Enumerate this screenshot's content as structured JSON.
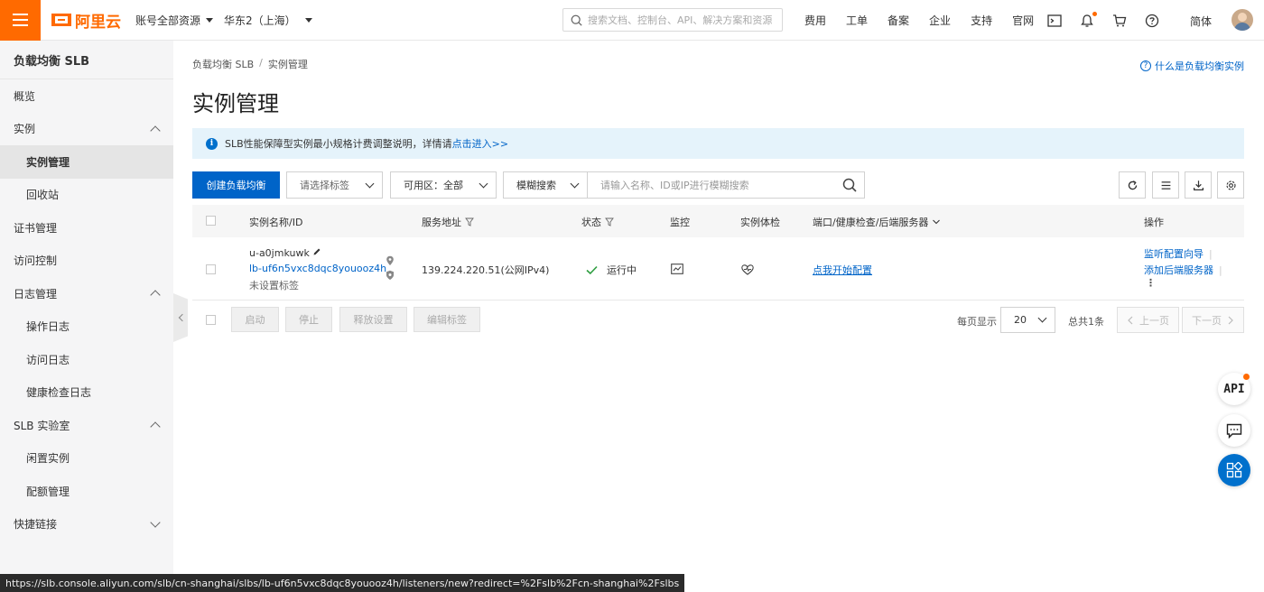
{
  "topbar": {
    "logo_text": "阿里云",
    "account_select": "账号全部资源",
    "region_select": "华东2（上海）",
    "search_placeholder": "搜索文档、控制台、API、解决方案和资源",
    "links": [
      "费用",
      "工单",
      "备案",
      "企业",
      "支持",
      "官网"
    ],
    "language": "简体",
    "accent_color": "#ff6a00"
  },
  "sidebar": {
    "title": "负载均衡 SLB",
    "items": [
      {
        "label": "概览",
        "level": 1
      },
      {
        "label": "实例",
        "level": 1,
        "expandable": true,
        "expanded": true
      },
      {
        "label": "实例管理",
        "level": 2,
        "active": true
      },
      {
        "label": "回收站",
        "level": 2
      },
      {
        "label": "证书管理",
        "level": 1
      },
      {
        "label": "访问控制",
        "level": 1
      },
      {
        "label": "日志管理",
        "level": 1,
        "expandable": true,
        "expanded": true
      },
      {
        "label": "操作日志",
        "level": 2
      },
      {
        "label": "访问日志",
        "level": 2
      },
      {
        "label": "健康检查日志",
        "level": 2
      },
      {
        "label": "SLB 实验室",
        "level": 1,
        "expandable": true,
        "expanded": true
      },
      {
        "label": "闲置实例",
        "level": 2
      },
      {
        "label": "配额管理",
        "level": 2
      },
      {
        "label": "快捷链接",
        "level": 1,
        "expandable": true,
        "expanded": false
      }
    ]
  },
  "main": {
    "breadcrumb": [
      "负载均衡 SLB",
      "实例管理"
    ],
    "help_link": "什么是负载均衡实例",
    "page_title": "实例管理",
    "notice": {
      "text": "SLB性能保障型实例最小规格计费调整说明，详情请",
      "link": "点击进入>>"
    },
    "toolbar": {
      "create_button": "创建负载均衡",
      "tag_select_placeholder": "请选择标签",
      "zone_label": "可用区：",
      "zone_value": "全部",
      "search_mode": "模糊搜索",
      "search_placeholder": "请输入名称、ID或IP进行模糊搜索"
    },
    "table": {
      "headers": {
        "name": "实例名称/ID",
        "address": "服务地址",
        "status": "状态",
        "monitor": "监控",
        "inspection": "实例体检",
        "ports": "端口/健康检查/后端服务器",
        "actions": "操作"
      },
      "rows": [
        {
          "name": "u-a0jmkuwk",
          "id": "lb-uf6n5vxc8dqc8youooz4h",
          "tag": "未设置标签",
          "address": "139.224.220.51(公网IPv4)",
          "status": "运行中",
          "ports_link": "点我开始配置",
          "action_1": "监听配置向导",
          "action_2": "添加后端服务器"
        }
      ]
    },
    "footer": {
      "batch_buttons": [
        "启动",
        "停止",
        "释放设置",
        "编辑标签"
      ],
      "page_size_label": "每页显示",
      "page_size": "20",
      "total": "总共1条",
      "prev": "上一页",
      "next": "下一页"
    }
  },
  "floating": {
    "api_label": "API"
  },
  "status_url": "https://slb.console.aliyun.com/slb/cn-shanghai/slbs/lb-uf6n5vxc8dqc8youooz4h/listeners/new?redirect=%2Fslb%2Fcn-shanghai%2Fslbs"
}
